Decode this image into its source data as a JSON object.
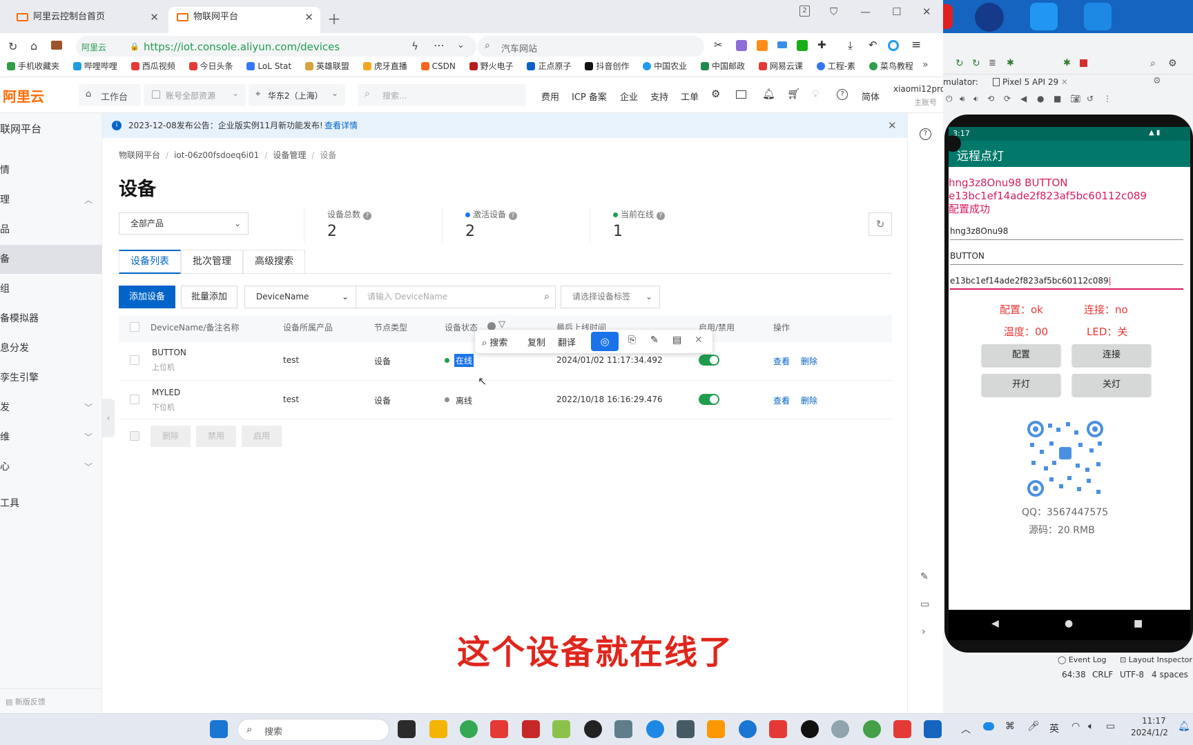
{
  "browser": {
    "tabs": [
      {
        "label": "阿里云控制台首页",
        "active": false
      },
      {
        "label": "物联网平台",
        "active": true
      }
    ],
    "tab_count_badge": "2",
    "url_domain": "阿里云",
    "url": "https://iot.console.aliyun.com/devices",
    "search_placeholder": "汽车网站",
    "bookmarks": [
      "手机收藏夹",
      "哔哩哔哩",
      "西瓜视频",
      "今日头条",
      "LoL Stat",
      "英雄联盟",
      "虎牙直播",
      "CSDN",
      "野火电子",
      "正点原子",
      "抖音创作",
      "中国农业",
      "中国邮政",
      "网易云课",
      "工程-素",
      "菜鸟教程"
    ]
  },
  "console": {
    "logo": "阿里云",
    "workbench": "工作台",
    "resource_scope": "账号全部资源",
    "region": "华东2（上海）",
    "search_placeholder": "搜索...",
    "nav": [
      "费用",
      "ICP 备案",
      "企业",
      "支持",
      "工单"
    ],
    "lang": "简体",
    "account": "xiaomi12pro",
    "account_sub": "主账号"
  },
  "sidebar": {
    "title": "联网平台",
    "items": [
      {
        "label": "情",
        "chevron": false
      },
      {
        "label": "理",
        "chevron": true
      },
      {
        "label": "品",
        "chevron": false
      },
      {
        "label": "备",
        "chevron": false,
        "active": true
      },
      {
        "label": "组",
        "chevron": false
      },
      {
        "label": "备模拟器",
        "chevron": false
      },
      {
        "label": "息分发",
        "chevron": false
      },
      {
        "label": "孪生引擎",
        "chevron": false
      },
      {
        "label": "发",
        "chevron": true
      },
      {
        "label": "维",
        "chevron": true
      },
      {
        "label": "心",
        "chevron": true
      },
      {
        "label": "工具",
        "chevron": false
      }
    ],
    "feedback": "新版反馈"
  },
  "notice": {
    "text": "2023-12-08发布公告：企业版实例11月新功能发布!",
    "link": "查看详情"
  },
  "page": {
    "breadcrumb": [
      "物联网平台",
      "iot-06z00fsdoeq6i01",
      "设备管理",
      "设备"
    ],
    "title": "设备",
    "product_select": "全部产品",
    "stats": [
      {
        "label": "设备总数",
        "value": "2",
        "dot": ""
      },
      {
        "label": "激活设备",
        "value": "2",
        "dot": "#1677ff"
      },
      {
        "label": "当前在线",
        "value": "1",
        "dot": "#1f9d4f"
      }
    ],
    "tabs": [
      "设备列表",
      "批次管理",
      "高级搜索"
    ],
    "toolbar": {
      "add": "添加设备",
      "batch_add": "批量添加",
      "field_select": "DeviceName",
      "search_placeholder": "请输入 DeviceName",
      "tag_select": "请选择设备标签"
    },
    "table": {
      "headers": [
        "DeviceName/备注名称",
        "设备所属产品",
        "节点类型",
        "设备状态",
        "最后上线时间",
        "启用/禁用",
        "操作"
      ],
      "rows": [
        {
          "name": "BUTTON",
          "note": "上位机",
          "product": "test",
          "node": "设备",
          "status": "在线",
          "status_color": "#1f9d4f",
          "last_online": "2024/01/02 11:17:34.492",
          "enabled": true,
          "view": "查看",
          "delete": "删除"
        },
        {
          "name": "MYLED",
          "note": "下位机",
          "product": "test",
          "node": "设备",
          "status": "离线",
          "status_color": "#8c8c8c",
          "last_online": "2022/10/18 16:16:29.476",
          "enabled": true,
          "view": "查看",
          "delete": "删除"
        }
      ],
      "batch_buttons": [
        "删除",
        "禁用",
        "启用"
      ]
    },
    "context_toolbar": [
      "搜索",
      "复制",
      "翻译"
    ]
  },
  "subtitle": "这个设备就在线了",
  "android_studio": {
    "emulator_label": "mulator:",
    "device_tab": "Pixel 5 API 29",
    "event_log": "Event Log",
    "layout_inspector": "Layout Inspector",
    "status": [
      "64:38",
      "CRLF",
      "UTF-8",
      "4 spaces"
    ]
  },
  "phone": {
    "time": "3:17",
    "app_title": "远程点灯",
    "log_lines": [
      "hng3z8Onu98  BUTTON",
      "e13bc1ef14ade2f823af5bc60112c089",
      "配置成功"
    ],
    "field1": "hng3z8Onu98",
    "field2": "BUTTON",
    "field3": "e13bc1ef14ade2f823af5bc60112c089",
    "config_status": "配置：ok",
    "connect_status": "连接：no",
    "temperature": "温度：00",
    "led": "LED：关",
    "buttons": [
      "配置",
      "连接",
      "开灯",
      "关灯"
    ],
    "qq": "QQ：3567447575",
    "price": "源码：20 RMB"
  },
  "taskbar": {
    "search": "搜索",
    "ime": "英",
    "time": "11:17",
    "date": "2024/1/2"
  }
}
